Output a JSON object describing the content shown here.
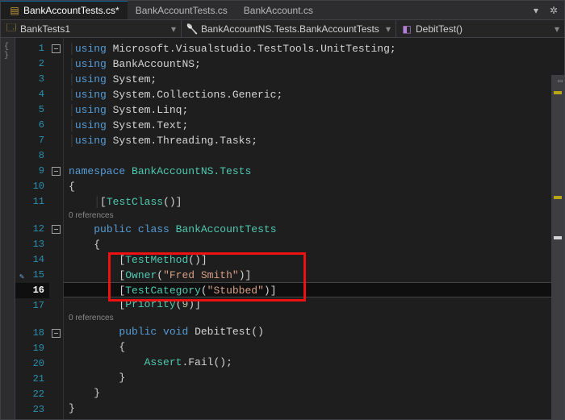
{
  "tabs": [
    {
      "label": "BankAccountTests.cs*",
      "active": true
    },
    {
      "label": "BankAccountTests.cs",
      "active": false
    },
    {
      "label": "BankAccount.cs",
      "active": false
    }
  ],
  "toolbar_icons": {
    "preview": "▾",
    "gear": "✲"
  },
  "navbar": {
    "scope": {
      "icon": "🗔",
      "label": "BankTests1"
    },
    "class": {
      "icon": "🥄",
      "label": "BankAccountNS.Tests.BankAccountTests"
    },
    "member": {
      "icon": "◧",
      "label": "DebitTest()"
    }
  },
  "codelens": {
    "refs_class": "0 references",
    "refs_method": "0 references"
  },
  "code": {
    "l1": [
      "using",
      ":",
      " Microsoft.Visualstudio.TestTools.UnitTesting;"
    ],
    "l2": [
      "using",
      ":",
      " BankAccountNS;"
    ],
    "l3": [
      "using",
      ":",
      " System;"
    ],
    "l4": [
      "using",
      ":",
      " System.Collections.Generic;"
    ],
    "l5": [
      "using",
      ":",
      " System.Linq;"
    ],
    "l6": [
      "using",
      ":",
      " System.Text;"
    ],
    "l7": [
      "using",
      ":",
      " System.Threading.Tasks;"
    ],
    "l9": [
      "namespace",
      ":",
      " BankAccountNS.Tests"
    ],
    "l10": "{",
    "l11": [
      "[",
      "TestClass",
      "()]"
    ],
    "l12": [
      "public",
      " ",
      "class",
      " ",
      "BankAccountTests"
    ],
    "l13": "{",
    "l14": [
      "[",
      "TestMethod",
      "()]"
    ],
    "l15": [
      "[",
      "Owner",
      "(",
      "\"Fred Smith\"",
      ")]"
    ],
    "l16": [
      "[",
      "TestCategory",
      "(",
      "\"Stubbed\"",
      ")]"
    ],
    "l17": [
      "[",
      "Priority",
      "(",
      "9",
      ")]"
    ],
    "l18": [
      "public",
      " ",
      "void",
      " ",
      "DebitTest",
      "()"
    ],
    "l19": "{",
    "l20": [
      "Assert",
      ".",
      "Fail",
      "();"
    ],
    "l21": "}",
    "l22": "}",
    "l23": "}"
  },
  "current_line": 16
}
